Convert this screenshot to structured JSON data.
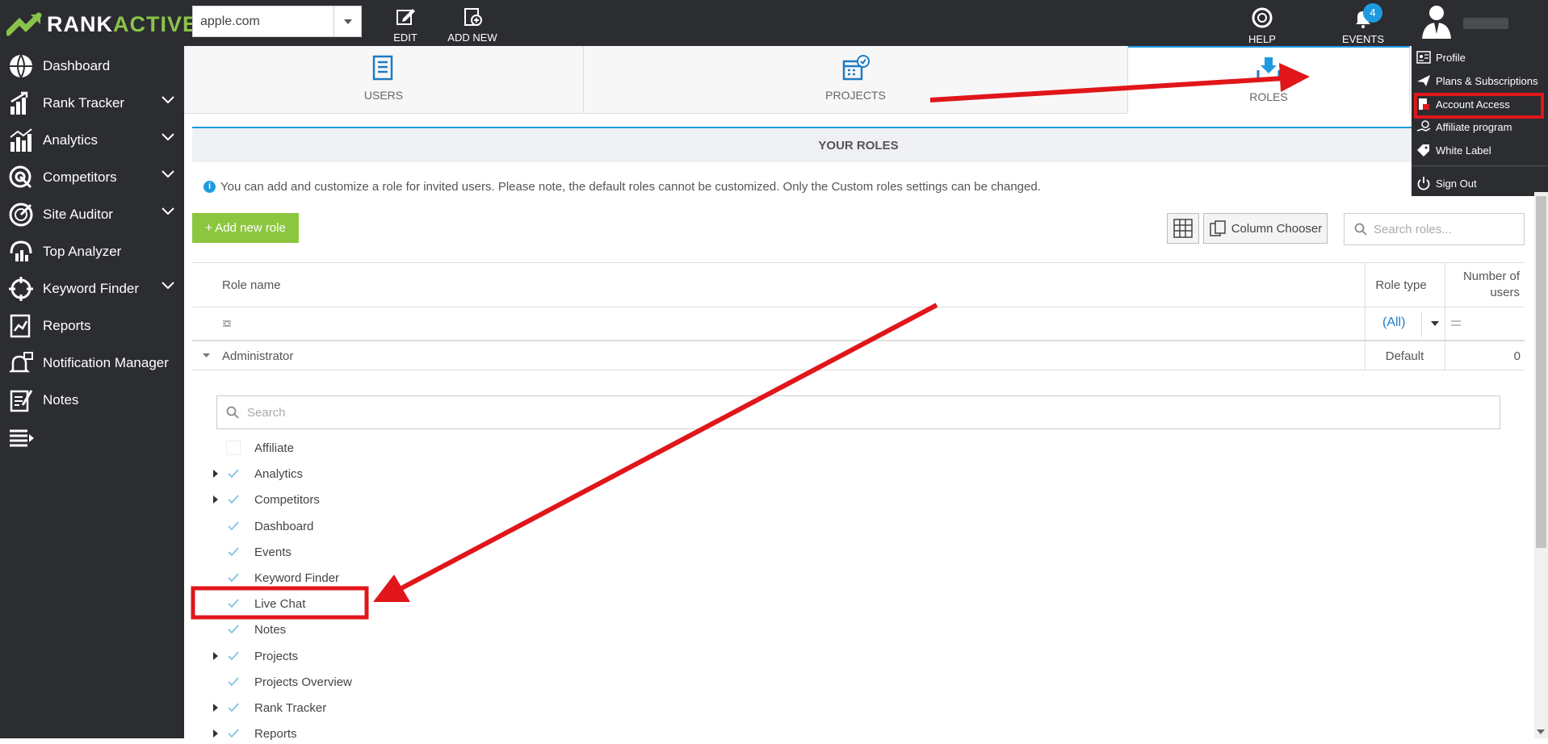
{
  "brand": {
    "part1": "RANK",
    "part2": "ACTIVE"
  },
  "project_select": {
    "value": "apple.com"
  },
  "toolbar": {
    "edit": "EDIT",
    "add_new": "ADD NEW",
    "help": "HELP",
    "events": "EVENTS",
    "events_count": "4"
  },
  "sidebar": {
    "items": [
      {
        "label": "Dashboard",
        "icon": "globe-icon",
        "expandable": false
      },
      {
        "label": "Rank Tracker",
        "icon": "bar-chart-up-icon",
        "expandable": true
      },
      {
        "label": "Analytics",
        "icon": "analytics-icon",
        "expandable": true
      },
      {
        "label": "Competitors",
        "icon": "target-icon",
        "expandable": true
      },
      {
        "label": "Site Auditor",
        "icon": "auditor-icon",
        "expandable": true
      },
      {
        "label": "Top Analyzer",
        "icon": "analyzer-icon",
        "expandable": false
      },
      {
        "label": "Keyword Finder",
        "icon": "crosshair-icon",
        "expandable": true
      },
      {
        "label": "Reports",
        "icon": "report-icon",
        "expandable": false
      },
      {
        "label": "Notification Manager",
        "icon": "bell-icon",
        "expandable": false
      },
      {
        "label": "Notes",
        "icon": "notes-icon",
        "expandable": false
      }
    ]
  },
  "tabs": [
    {
      "label": "USERS",
      "icon": "users-list-icon"
    },
    {
      "label": "PROJECTS",
      "icon": "projects-calendar-icon"
    },
    {
      "label": "ROLES",
      "icon": "roles-download-icon",
      "active": true
    }
  ],
  "section_title": "YOUR ROLES",
  "info_text": "You can add and customize a role for invited users. Please note, the default roles cannot be customized. Only the Custom roles settings can be changed.",
  "buttons": {
    "add_role": "+ Add new role",
    "column_chooser": "Column Chooser"
  },
  "search_roles": {
    "placeholder": "Search roles..."
  },
  "table": {
    "columns": {
      "role_name": "Role name",
      "role_type": "Role type",
      "num_users": "Number of users"
    },
    "filter_all": "(All)",
    "rows": [
      {
        "name": "Administrator",
        "type": "Default",
        "users": "0"
      }
    ]
  },
  "detail": {
    "search_placeholder": "Search",
    "permissions": [
      {
        "label": "Affiliate",
        "checked": false,
        "expandable": false
      },
      {
        "label": "Analytics",
        "checked": true,
        "expandable": true
      },
      {
        "label": "Competitors",
        "checked": true,
        "expandable": true
      },
      {
        "label": "Dashboard",
        "checked": true,
        "expandable": false
      },
      {
        "label": "Events",
        "checked": true,
        "expandable": false
      },
      {
        "label": "Keyword Finder",
        "checked": true,
        "expandable": false
      },
      {
        "label": "Live Chat",
        "checked": true,
        "expandable": false
      },
      {
        "label": "Notes",
        "checked": true,
        "expandable": false
      },
      {
        "label": "Projects",
        "checked": true,
        "expandable": true
      },
      {
        "label": "Projects Overview",
        "checked": true,
        "expandable": false
      },
      {
        "label": "Rank Tracker",
        "checked": true,
        "expandable": true
      },
      {
        "label": "Reports",
        "checked": true,
        "expandable": true
      }
    ]
  },
  "user_menu": {
    "items": [
      {
        "label": "Profile",
        "icon": "profile-card-icon"
      },
      {
        "label": "Plans & Subscriptions",
        "icon": "paper-plane-icon"
      },
      {
        "label": "Account Access",
        "icon": "account-access-icon",
        "highlighted": true
      },
      {
        "label": "Affiliate program",
        "icon": "affiliate-icon"
      },
      {
        "label": "White Label",
        "icon": "tag-icon"
      },
      {
        "label": "Sign Out",
        "icon": "power-icon"
      }
    ]
  },
  "colors": {
    "accent": "#1e9be0",
    "green": "#8cc63f",
    "dark": "#2b2d31",
    "annotation": "#e0161b"
  }
}
